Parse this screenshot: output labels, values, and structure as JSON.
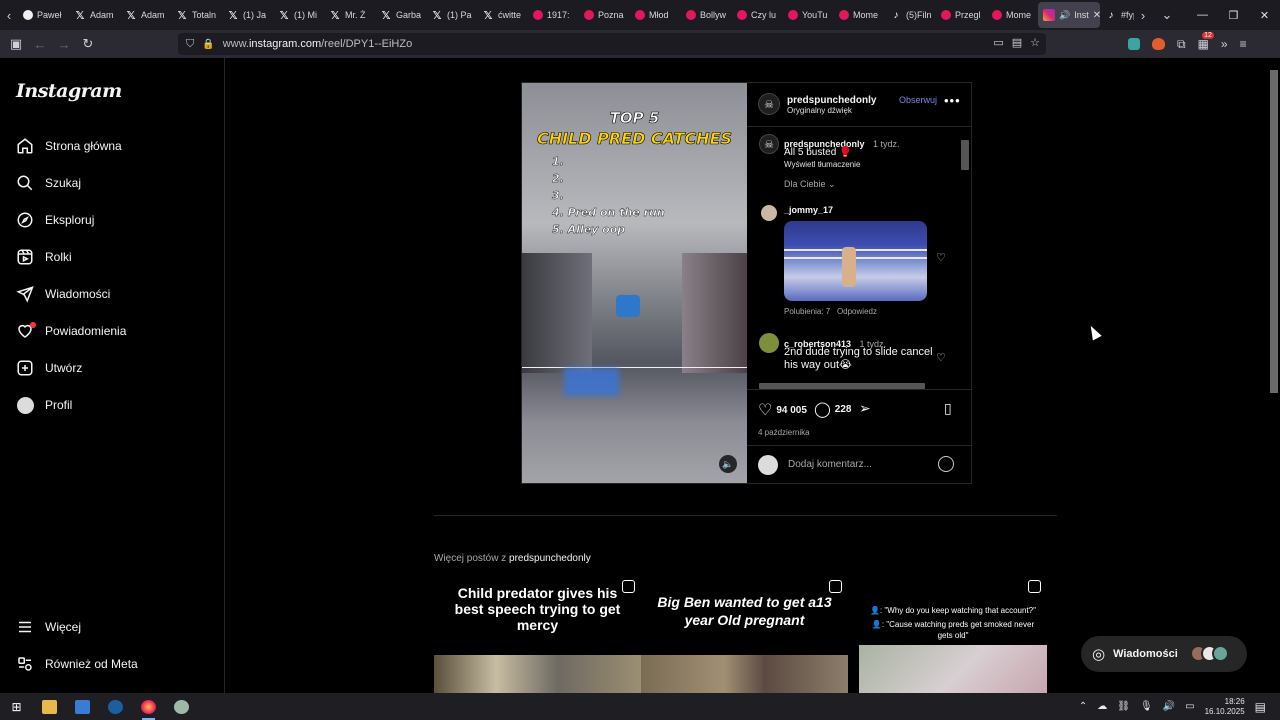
{
  "browser": {
    "tabs": [
      {
        "label": "Paweł",
        "icon": "pw"
      },
      {
        "label": "Adam",
        "icon": "x"
      },
      {
        "label": "Adam",
        "icon": "x"
      },
      {
        "label": "Totaln",
        "icon": "x"
      },
      {
        "label": "(1) Ja",
        "icon": "x"
      },
      {
        "label": "(1) Mi",
        "icon": "x"
      },
      {
        "label": "Mr. Ż",
        "icon": "x"
      },
      {
        "label": "Garba",
        "icon": "x"
      },
      {
        "label": "(1) Pa",
        "icon": "x"
      },
      {
        "label": "ćwitte",
        "icon": "x"
      },
      {
        "label": "1917:",
        "icon": "yt"
      },
      {
        "label": "Pozna",
        "icon": "yt"
      },
      {
        "label": "Młod",
        "icon": "yt"
      },
      {
        "label": "Bollyw",
        "icon": "yt"
      },
      {
        "label": "Czy lu",
        "icon": "yt"
      },
      {
        "label": "YouTu",
        "icon": "yt"
      },
      {
        "label": "Mome",
        "icon": "yt"
      },
      {
        "label": "(5)Filn",
        "icon": "tk"
      },
      {
        "label": "Przegl",
        "icon": "yt"
      },
      {
        "label": "Mome",
        "icon": "yt"
      }
    ],
    "active_tab": "Inst",
    "next_tab": "#fyp",
    "url_prefix": "www.",
    "url_domain": "instagram.com",
    "url_path": "/reel/DPY1--EiHZo",
    "ext_badge": "12"
  },
  "sidebar": {
    "logo": "Instagram",
    "items": [
      {
        "label": "Strona główna",
        "icon": "home-icon"
      },
      {
        "label": "Szukaj",
        "icon": "search-icon"
      },
      {
        "label": "Eksploruj",
        "icon": "compass-icon"
      },
      {
        "label": "Rolki",
        "icon": "reels-icon"
      },
      {
        "label": "Wiadomości",
        "icon": "send-icon"
      },
      {
        "label": "Powiadomienia",
        "icon": "heart-icon"
      },
      {
        "label": "Utwórz",
        "icon": "plus-icon"
      },
      {
        "label": "Profil",
        "icon": "avatar"
      }
    ],
    "bottom": [
      {
        "label": "Więcej",
        "icon": "menu-icon"
      },
      {
        "label": "Również od Meta",
        "icon": "meta-icon"
      }
    ]
  },
  "post": {
    "media": {
      "title_line1": "TOP 5",
      "title_line2": "CHILD PRED CATCHES",
      "list": [
        "1.",
        "2.",
        "3.",
        "4. Pred on the run",
        "5. Alley oop"
      ]
    },
    "header": {
      "username": "predspunchedonly",
      "audio": "Oryginalny dźwięk",
      "follow": "Obserwuj"
    },
    "caption": {
      "username": "predspunchedonly",
      "time": "1 tydz.",
      "text": "All 5 busted 🥊",
      "translate": "Wyświetl tłumaczenie"
    },
    "for_you": "Dla Ciebie",
    "comments": [
      {
        "username": "_jommy_17",
        "likes": "Polubienia: 7",
        "reply": "Odpowiedz"
      },
      {
        "username": "c_robertson413",
        "time": "1 tydz.",
        "text": "2nd dude trying to slide cancel his way out😭"
      }
    ],
    "likes": "94 005",
    "comment_count": "228",
    "date": "4 października",
    "add_comment_placeholder": "Dodaj komentarz..."
  },
  "more_posts": {
    "label": "Więcej postów z ",
    "username": "predspunchedonly",
    "cards": [
      {
        "text": "Child predator gives his best speech trying to get mercy"
      },
      {
        "text": "Big Ben wanted to get a13 year Old pregnant"
      },
      {
        "line1": "👤: \"Why do you keep watching that account?\"",
        "line2": "👤: \"Cause watching preds get smoked never gets old\""
      }
    ]
  },
  "messages_button": "Wiadomości",
  "taskbar": {
    "time": "18:26",
    "date": "16.10.2025"
  }
}
